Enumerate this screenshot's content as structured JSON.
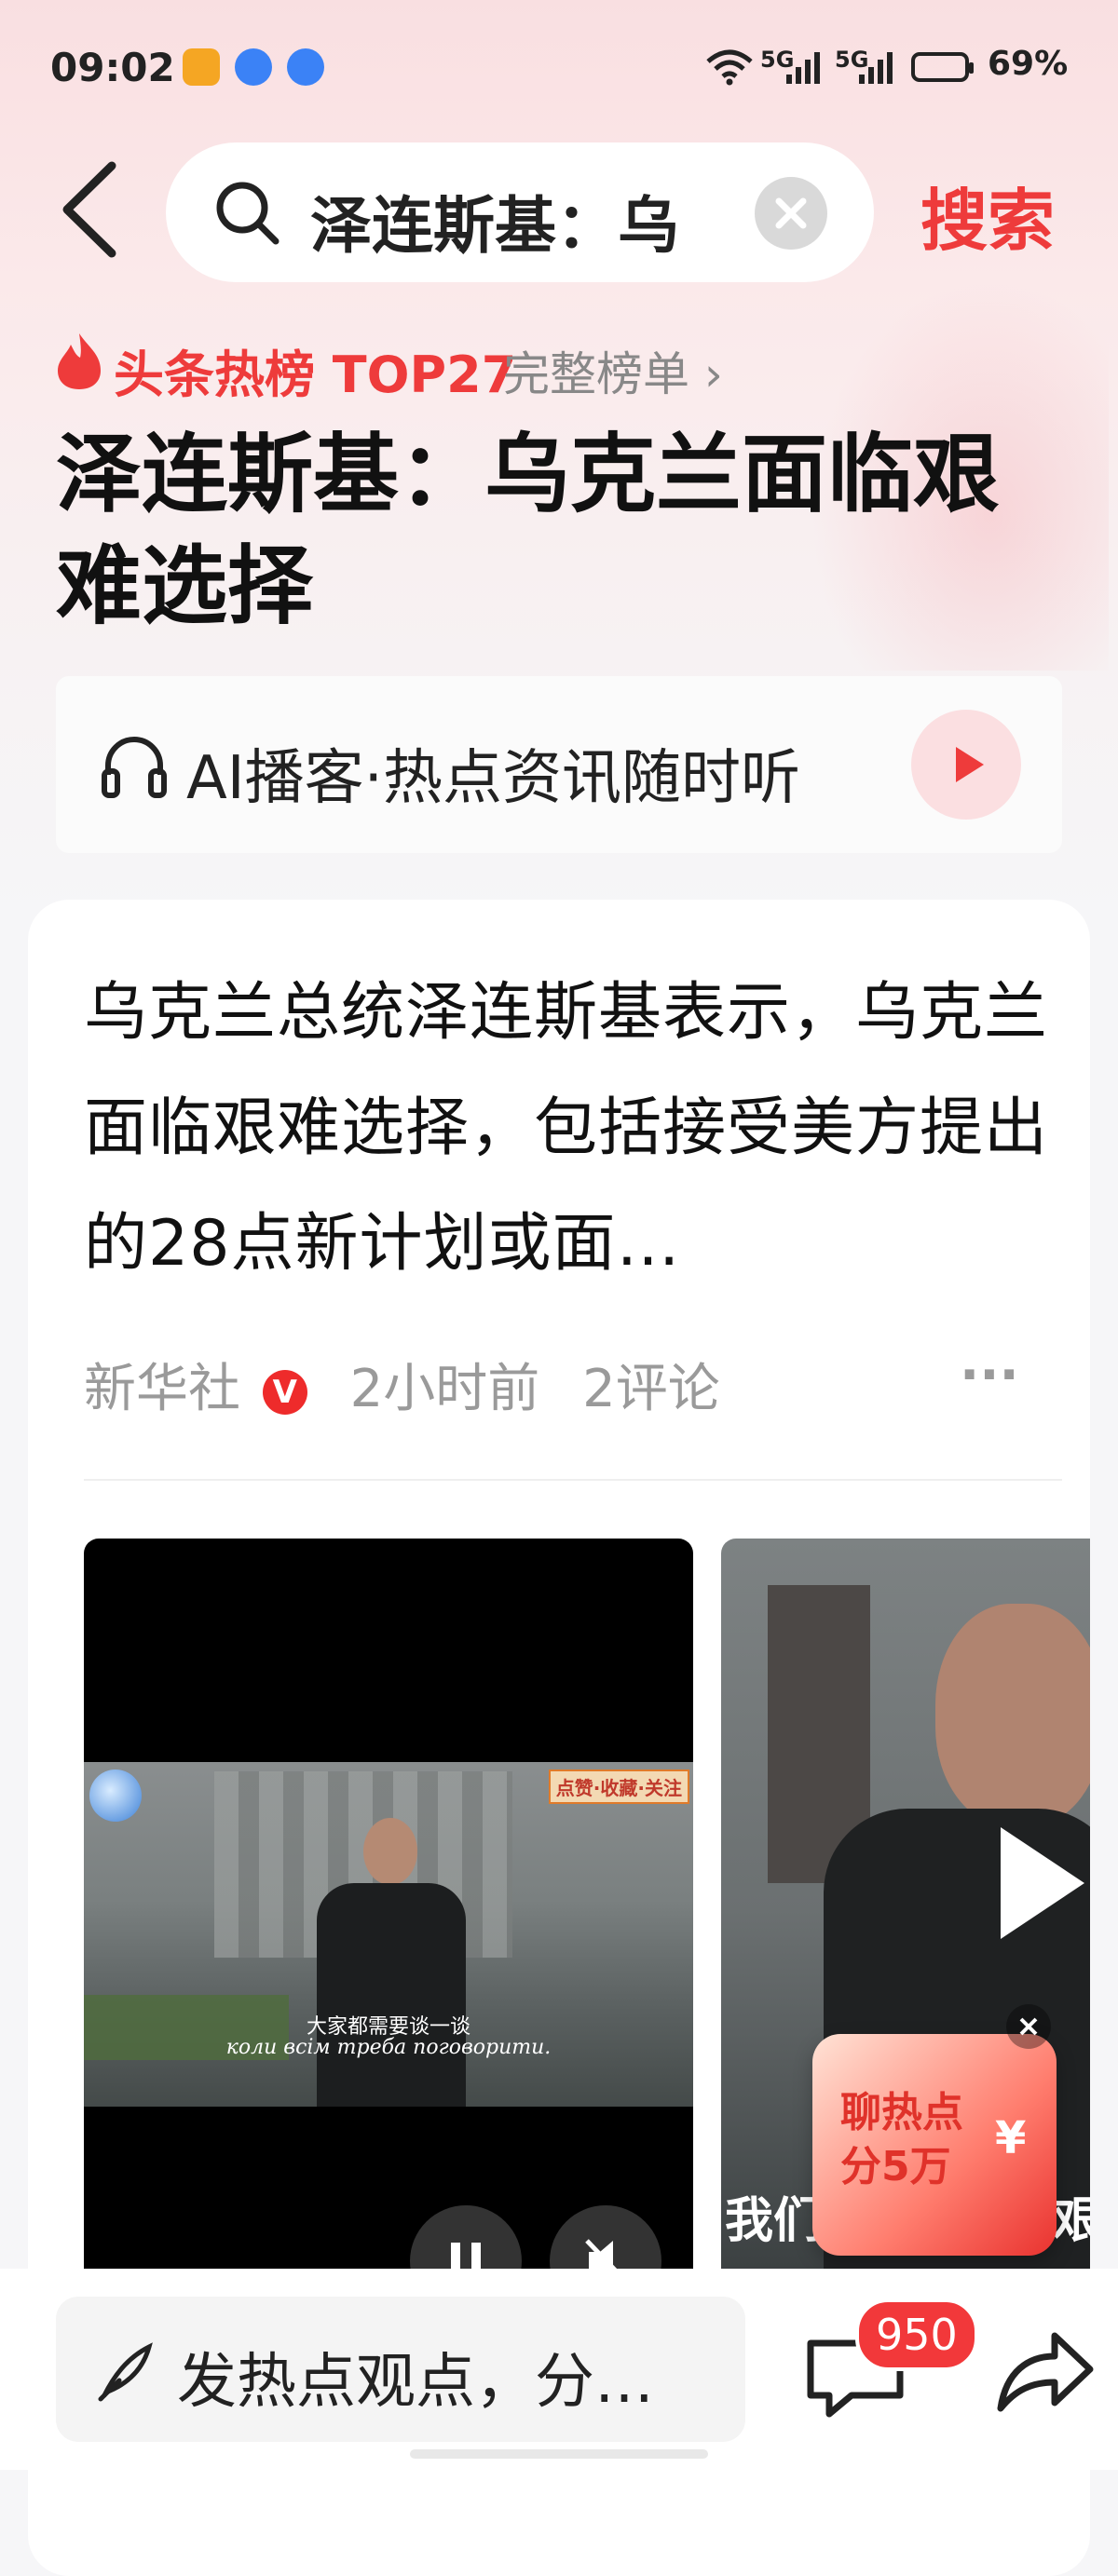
{
  "status_bar": {
    "time": "09:02",
    "signal1": "5G",
    "signal2": "5G",
    "battery": "69%"
  },
  "search": {
    "query": "泽连斯基：乌",
    "button_label": "搜索"
  },
  "hot_list": {
    "label": "头条热榜 TOP27",
    "full_list_link": "完整榜单 ›",
    "headline": "泽连斯基：乌克兰面临艰难选择"
  },
  "ai_podcast": {
    "label": "AI播客·热点资讯随时听"
  },
  "article": {
    "summary": "乌克兰总统泽连斯基表示，乌克兰面临艰难选择，包括接受美方提出的28点新计划或面…",
    "source": "新华社",
    "verified_badge": "V",
    "time_ago": "2小时前",
    "comments": "2评论",
    "more": "···",
    "video1": {
      "corner_tag": "点赞·收藏·关注",
      "subtitle_cn": "大家都需要谈一谈",
      "subtitle_ua": "коли всім треба поговорити."
    },
    "video2": {
      "caption": "我们",
      "caption_right": "艰"
    }
  },
  "promo": {
    "line1": "聊热点",
    "line2": "分5万",
    "currency": "¥"
  },
  "bottom_bar": {
    "comment_placeholder": "发热点观点，分…",
    "comment_count": "950"
  },
  "colors": {
    "accent_red": "#ee3b3b",
    "badge_red": "#f2383a"
  }
}
